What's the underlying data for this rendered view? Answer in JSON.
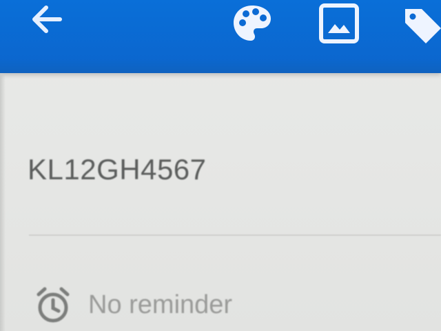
{
  "toolbar": {
    "color": "#0b6ad4",
    "icons": {
      "back": "arrow-back-icon",
      "palette": "palette-icon",
      "image": "image-icon",
      "label": "label-tag-icon"
    }
  },
  "note": {
    "title": "KL12GH4567"
  },
  "reminder": {
    "icon": "alarm-clock-icon",
    "label": "No reminder"
  }
}
